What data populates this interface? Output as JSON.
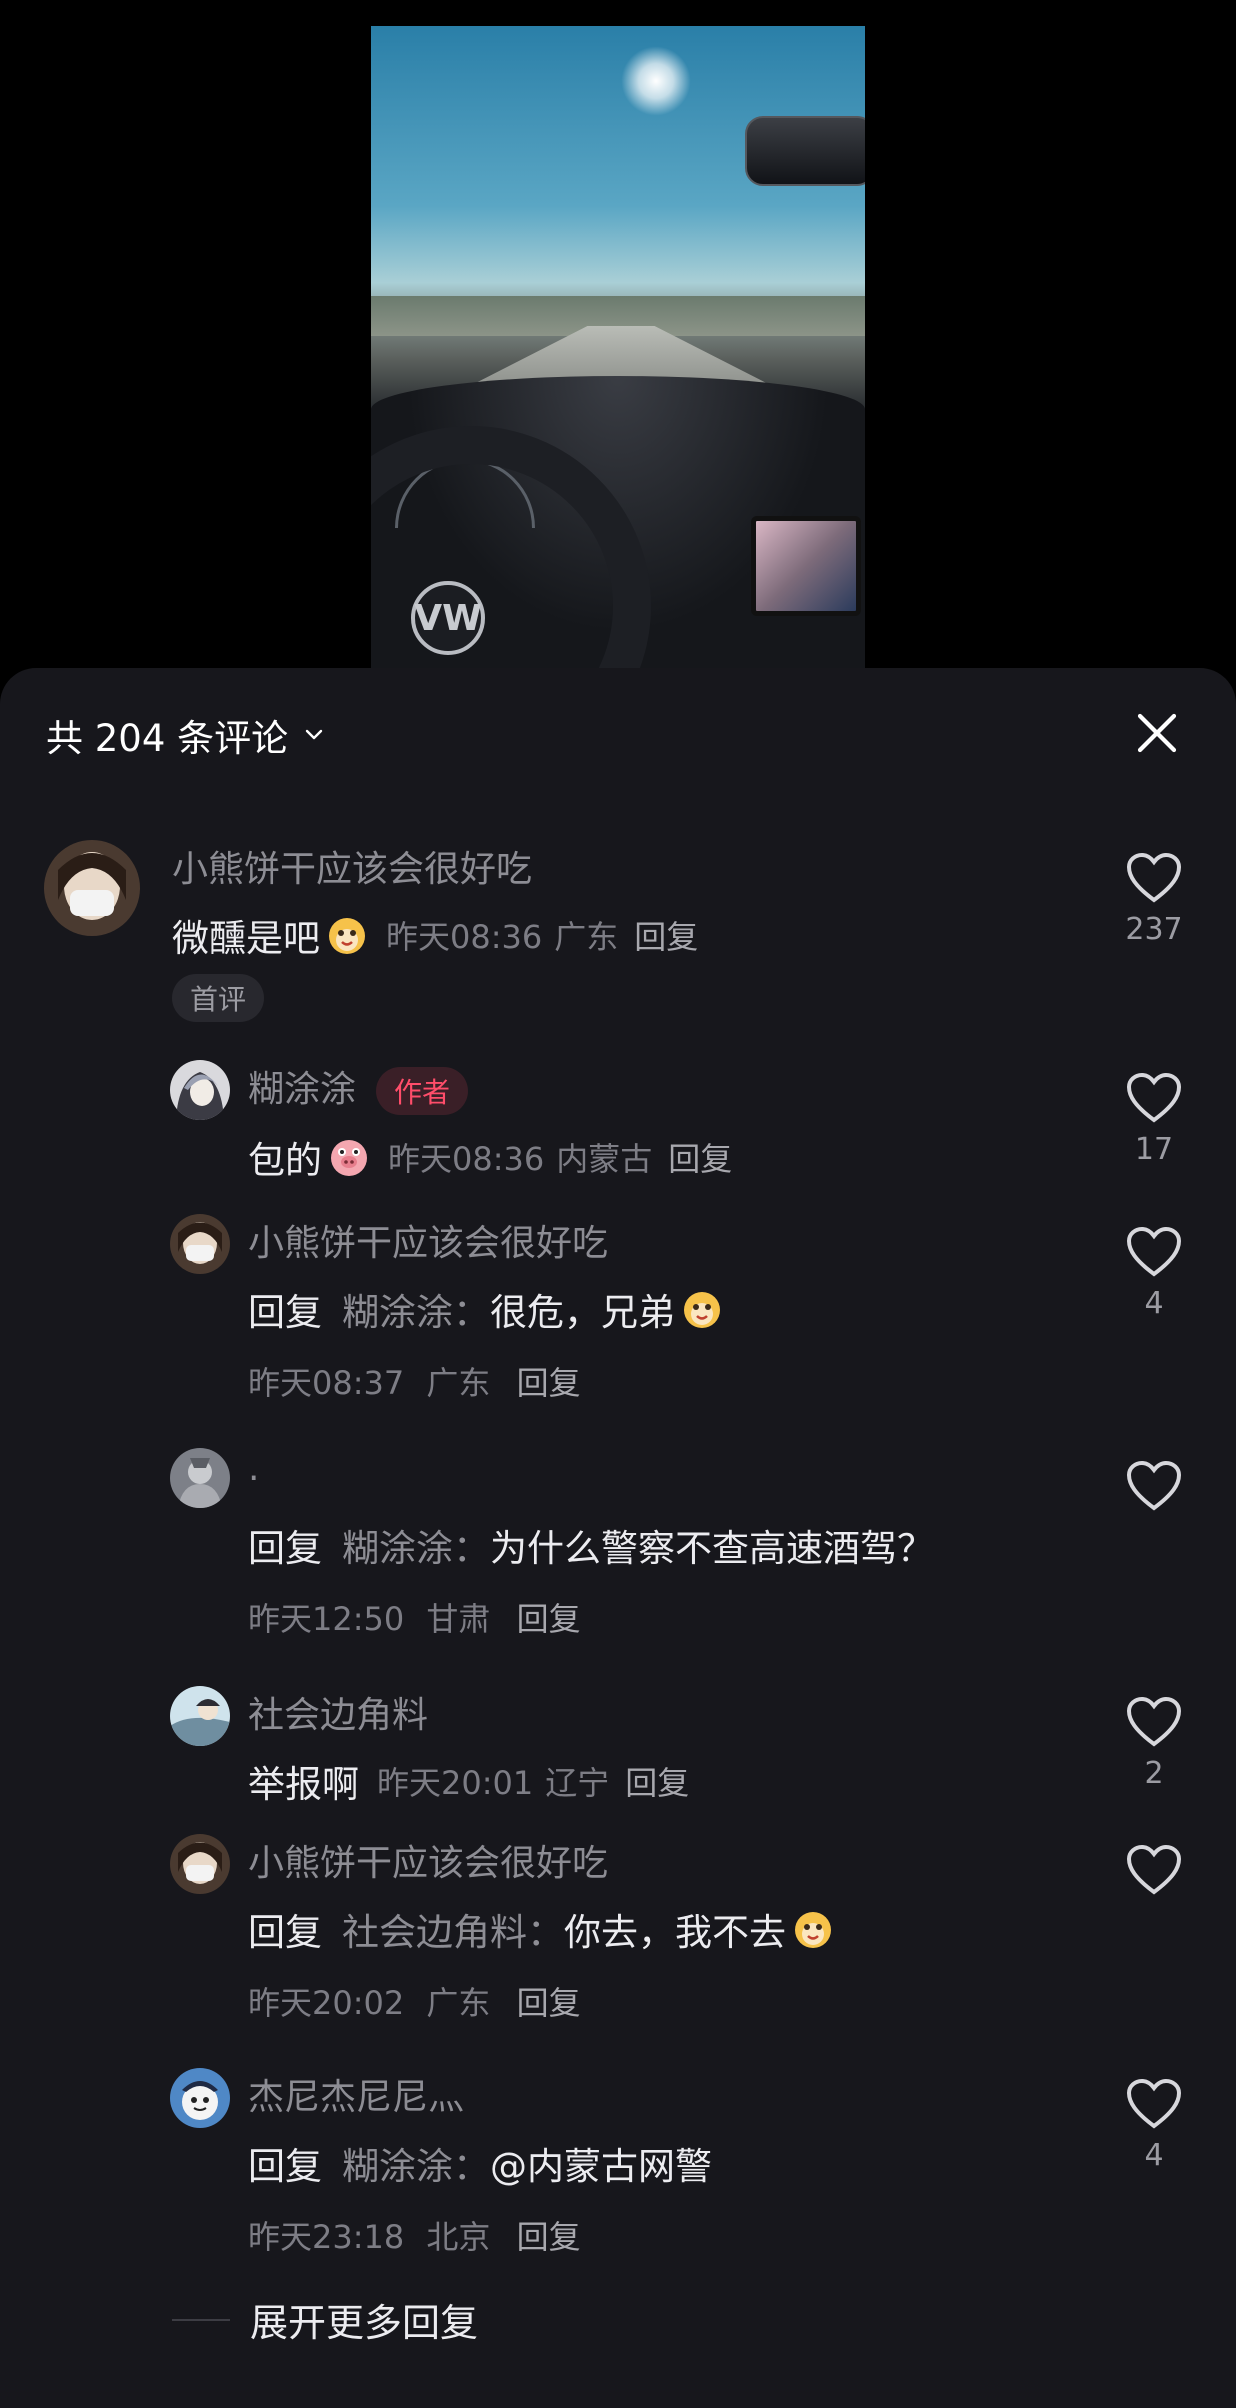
{
  "header": {
    "title": "共 204 条评论"
  },
  "comments": [
    {
      "user": "小熊饼干应该会很好吃",
      "text": "微醺是吧",
      "time": "昨天08:36",
      "location": "广东",
      "reply_label": "回复",
      "tag": "首评",
      "likes": "237"
    },
    {
      "user": "糊涂涂",
      "badge": "作者",
      "text": "包的",
      "time": "昨天08:36",
      "location": "内蒙古",
      "reply_label": "回复",
      "likes": "17"
    },
    {
      "user": "小熊饼干应该会很好吃",
      "reply_prefix": "回复",
      "reply_target": "糊涂涂：",
      "text": "很危，兄弟",
      "time": "昨天08:37",
      "location": "广东",
      "reply_label": "回复",
      "likes": "4"
    },
    {
      "user": ".",
      "reply_prefix": "回复",
      "reply_target": "糊涂涂：",
      "text": "为什么警察不查高速酒驾？",
      "time": "昨天12:50",
      "location": "甘肃",
      "reply_label": "回复",
      "likes": ""
    },
    {
      "user": "社会边角料",
      "text": "举报啊",
      "time": "昨天20:01",
      "location": "辽宁",
      "reply_label": "回复",
      "likes": "2"
    },
    {
      "user": "小熊饼干应该会很好吃",
      "reply_prefix": "回复",
      "reply_target": "社会边角料：",
      "text": "你去，我不去",
      "time": "昨天20:02",
      "location": "广东",
      "reply_label": "回复",
      "likes": ""
    },
    {
      "user": "杰尼杰尼尼灬",
      "reply_prefix": "回复",
      "reply_target": "糊涂涂：",
      "text": "@内蒙古网警",
      "time": "昨天23:18",
      "location": "北京",
      "reply_label": "回复",
      "likes": "4"
    }
  ],
  "expand_label": "展开更多回复",
  "icons": {
    "dropdown": "chevron-down-icon",
    "close": "close-icon",
    "like": "heart-icon"
  },
  "colors": {
    "sheet_bg": "#17171c",
    "author_badge": "#ff4d6a"
  }
}
